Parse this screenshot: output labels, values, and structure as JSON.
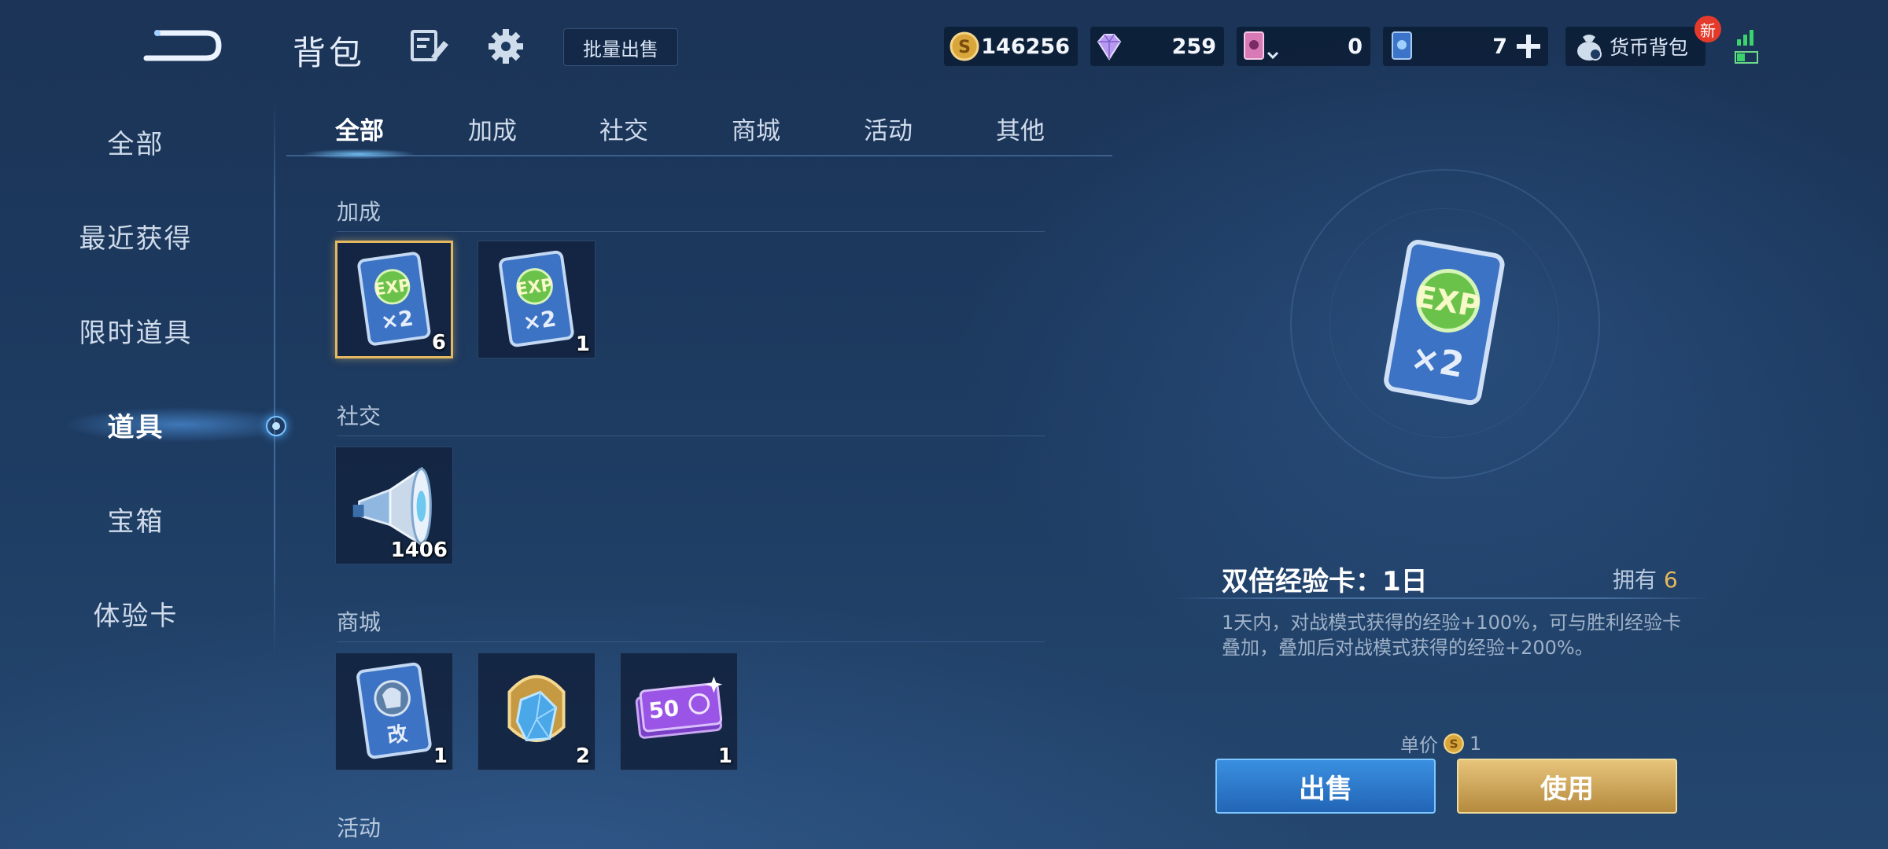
{
  "header": {
    "title": "背包",
    "bulk_sell": "批量出售",
    "currencies": [
      {
        "name": "gold-coin",
        "value": "146256"
      },
      {
        "name": "diamond",
        "value": "259"
      },
      {
        "name": "pink-card",
        "value": "0"
      },
      {
        "name": "blue-card",
        "value": "7"
      }
    ],
    "currency_bag": "货币背包",
    "new_badge": "新"
  },
  "sidebar": {
    "items": [
      {
        "label": "全部",
        "active": false
      },
      {
        "label": "最近获得",
        "active": false
      },
      {
        "label": "限时道具",
        "active": false
      },
      {
        "label": "道具",
        "active": true
      },
      {
        "label": "宝箱",
        "active": false
      },
      {
        "label": "体验卡",
        "active": false
      }
    ]
  },
  "tabs": [
    "全部",
    "加成",
    "社交",
    "商城",
    "活动",
    "其他"
  ],
  "active_tab": "全部",
  "sections": [
    {
      "title": "加成",
      "items": [
        {
          "icon": "exp-double-card-icon",
          "count": "6",
          "selected": true
        },
        {
          "icon": "exp-double-card-icon",
          "count": "1",
          "selected": false
        }
      ]
    },
    {
      "title": "社交",
      "items": [
        {
          "icon": "megaphone-icon",
          "count": "1406",
          "selected": false
        }
      ]
    },
    {
      "title": "商城",
      "items": [
        {
          "icon": "rename-card-icon",
          "count": "1",
          "selected": false
        },
        {
          "icon": "crystal-gem-icon",
          "count": "2",
          "selected": false
        },
        {
          "icon": "ticket-50-icon",
          "count": "1",
          "selected": false
        }
      ]
    },
    {
      "title": "活动",
      "items": []
    }
  ],
  "detail": {
    "name": "双倍经验卡：1日",
    "owned_label": "拥有",
    "owned_count": "6",
    "description": "1天内，对战模式获得的经验+100%，可与胜利经验卡叠加，叠加后对战模式获得的经验+200%。",
    "price_label": "单价",
    "price_value": "1",
    "sell_label": "出售",
    "use_label": "使用"
  },
  "colors": {
    "accent_gold": "#e3b860",
    "sell_blue": "#2f7ed0",
    "use_gold": "#d0a85c",
    "owned_count": "#e8b95a"
  }
}
